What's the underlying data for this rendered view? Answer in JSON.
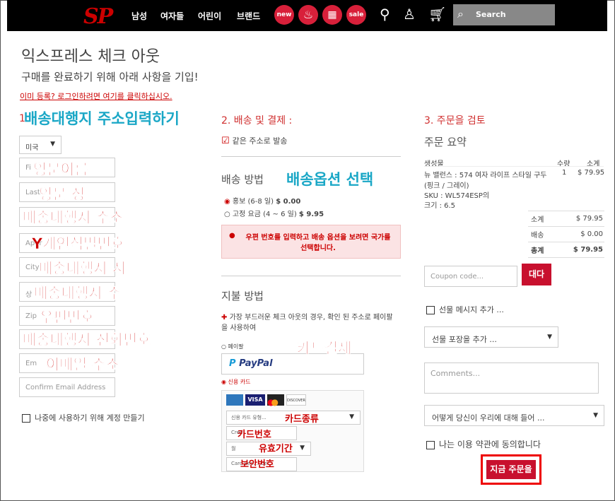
{
  "header": {
    "logo": "SP",
    "nav": [
      "남성",
      "여자들",
      "어린이",
      "브랜드"
    ],
    "badges": [
      "new",
      "hot",
      "cal",
      "sale"
    ],
    "search_placeholder": "Search"
  },
  "page": {
    "title": "익스프레스 체크 아웃",
    "subtitle": "구매를 완료하기 위해 아래 사항을 기입!",
    "login_link": "이미 등록? 로그인하려면 여기를 클릭하십시오."
  },
  "step1": {
    "label": "1.",
    "country": "미국",
    "fields": [
      "Fi",
      "Last",
      "",
      "Apar",
      "City",
      "상",
      "Zip",
      "",
      "Em",
      "Confirm Email Address"
    ],
    "create_account": "나중에 사용하기 위해 계정 만들기"
  },
  "step2": {
    "title": "2. 배송 및 결제 :",
    "same_address": "같은 주소로 발송",
    "shipping_title": "배송 방법",
    "options": [
      {
        "label": "홍보 (6-8 일)",
        "price": "$ 0.00"
      },
      {
        "label": "고정 요금 (4 ~ 6 일)",
        "price": "$ 9.95"
      }
    ],
    "alert": "우편 번호를 입력하고 배송 옵션을 보려면 국가를 선택합니다.",
    "payment_title": "지불 방법",
    "payment_note": "가장 부드러운 체크 아웃의 경우, 확인 된 주소로 페이팔을 사용하여",
    "paypal_radio": "페이팔",
    "paypal_logo": "PayPal",
    "card_radio": "신용 카드",
    "card_type": "신용 카드 유형...",
    "card_number": "Cred",
    "exp_month": "월",
    "cvv": "Card Sec.....ber..."
  },
  "step3": {
    "title": "3. 주문을 검토",
    "summary_title": "주문 요약",
    "col_product": "생성물",
    "col_qty": "수량",
    "col_subtotal": "소계",
    "item_name": "뉴 밸런스 : 574 여자 라이프 스타일 구두 (핑크 / 그레이)",
    "item_sku": "SKU : WL574ESP의",
    "item_size": "크기 : 6.5",
    "item_qty": "1",
    "item_price": "$ 79.95",
    "subtotal_label": "소계",
    "subtotal": "$ 79.95",
    "shipping_label": "배송",
    "shipping": "$ 0.00",
    "total_label": "총계",
    "total": "$ 79.95",
    "coupon_placeholder": "Coupon code...",
    "coupon_btn": "대다",
    "gift_message": "선물 메시지 추가 ...",
    "gift_wrap": "선물 포장을 추가 ...",
    "comments_placeholder": "Comments...",
    "heard": "어떻게 당신이 우리에 대해 들어 ...",
    "terms": "나는 이용 약관에 동의합니다",
    "order_btn": "지금 주문을"
  },
  "annotations": {
    "a1": "배송대행지 주소입력하기",
    "a2": "영문이름",
    "a3": "영문 성",
    "a4": "배송대행지 주소",
    "a5": "Y개인식별번호",
    "a6": "배송대행지 시",
    "a7": "배송대행지 주",
    "a8": "우편번호",
    "a9": "배송대행지 전화번호",
    "a10": "이메일 주소",
    "a11": "배송옵션 선택",
    "a12": "카드결제",
    "a13": "카드종류",
    "a14": "카드번호",
    "a15": "유효기간",
    "a16": "보안번호"
  },
  "colors": {
    "accent": "#d03030",
    "button": "#c8102e",
    "header": "#000000"
  }
}
